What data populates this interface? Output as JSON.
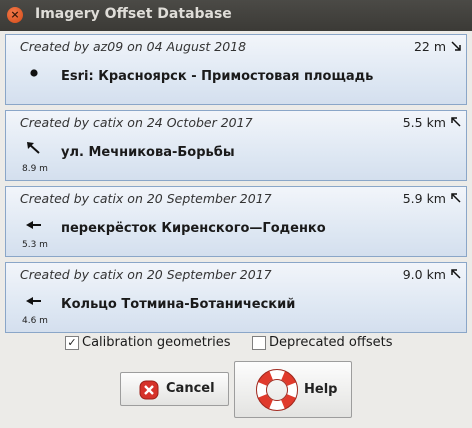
{
  "window": {
    "title": "Imagery Offset Database",
    "close_glyph": "×"
  },
  "offsets": [
    {
      "created": "Created by az09 on 04 August 2018",
      "distance": "22 m",
      "direction_icon": "arrow-down-right-icon",
      "type_icon": "dot-icon",
      "icon_label": "",
      "name": "Esri: Красноярск - Примостовая площадь"
    },
    {
      "created": "Created by catix on 24 October 2017",
      "distance": "5.5 km",
      "direction_icon": "arrow-up-left-icon",
      "type_icon": "arrow-up-left-icon",
      "icon_label": "8.9 m",
      "name": "ул. Мечникова-Борьбы"
    },
    {
      "created": "Created by catix on 20 September 2017",
      "distance": "5.9 km",
      "direction_icon": "arrow-up-left-icon",
      "type_icon": "arrow-left-icon",
      "icon_label": "5.3 m",
      "name": "перекрёсток Киренского—Годенко"
    },
    {
      "created": "Created by catix on 20 September 2017",
      "distance": "9.0 km",
      "direction_icon": "arrow-up-left-icon",
      "type_icon": "arrow-left-icon",
      "icon_label": "4.6 m",
      "name": "Кольцо Тотмина-Ботанический"
    }
  ],
  "options": {
    "calibration_label": "Calibration geometries",
    "calibration_checked": "✓",
    "deprecated_label": "Deprecated offsets",
    "deprecated_checked": ""
  },
  "buttons": {
    "cancel_label": "Cancel",
    "help_label": "Help"
  },
  "colors": {
    "item_border": "#8aa6c8",
    "cancel_icon": "#d6322a",
    "help_ring": "#e03a2c"
  }
}
